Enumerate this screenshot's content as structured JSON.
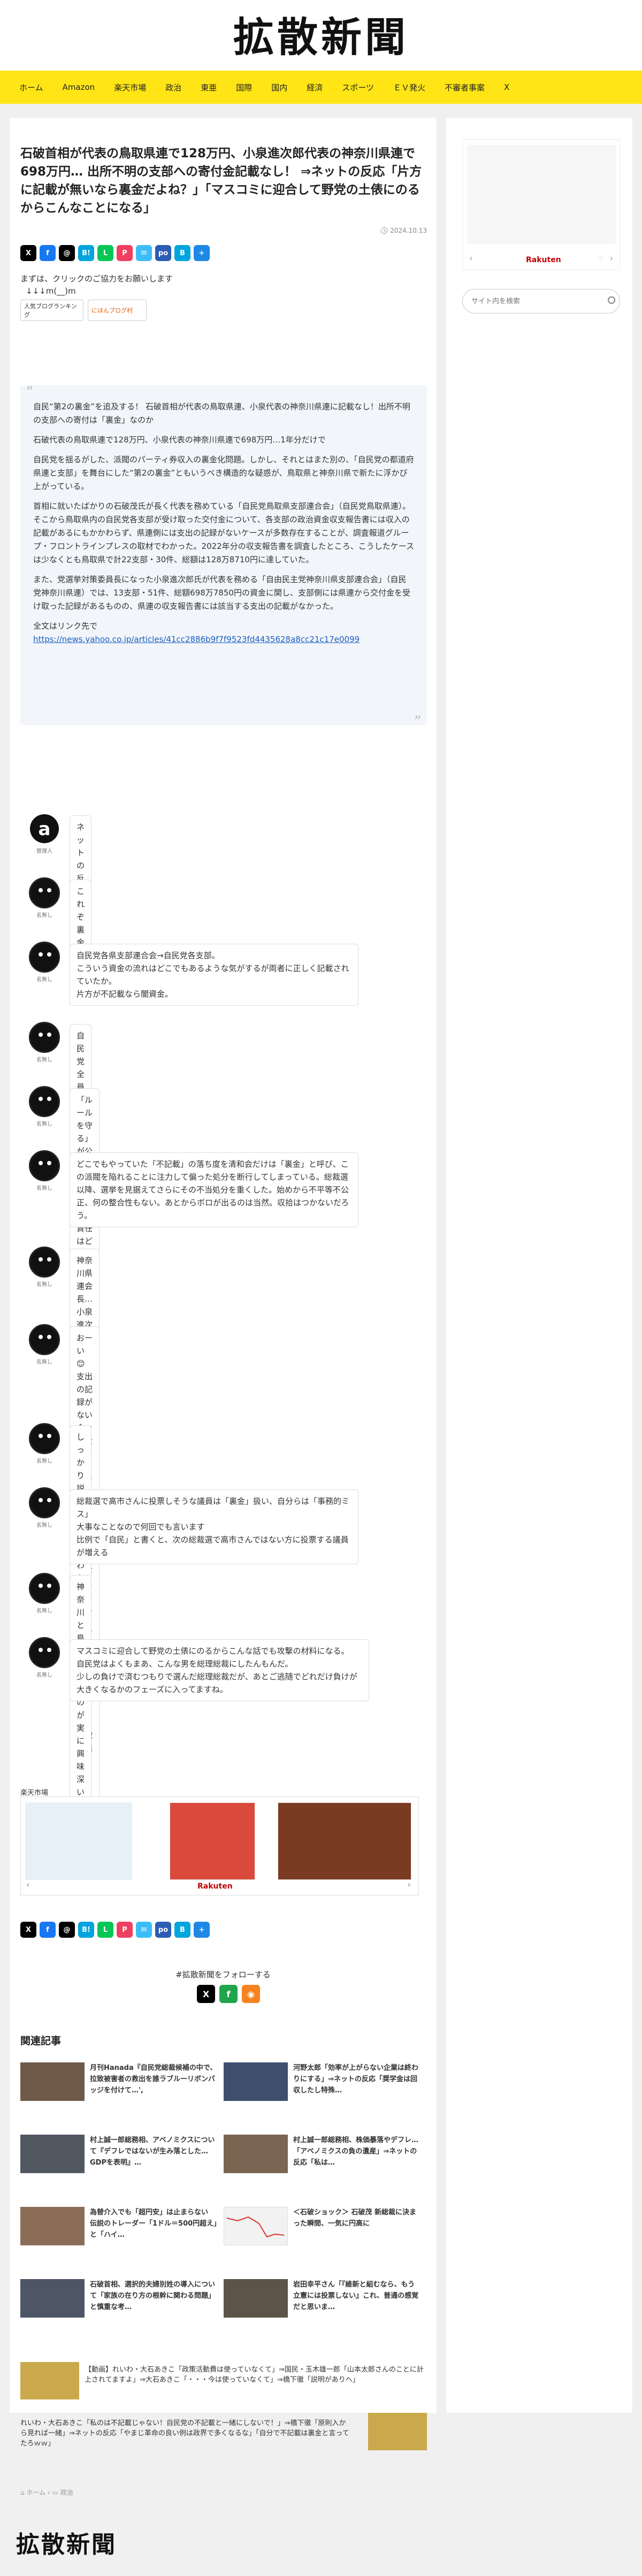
{
  "site": {
    "logo": "拡散新聞"
  },
  "nav": [
    "ホーム",
    "Amazon",
    "楽天市場",
    "政治",
    "東亜",
    "国際",
    "国内",
    "経済",
    "スポーツ",
    "ＥＶ発火",
    "不審者事案",
    "X"
  ],
  "article": {
    "title": "石破首相が代表の鳥取県連で128万円、小泉進次郎代表の神奈川県連で698万円… 出所不明の支部への寄付金記載なし！ ⇒ネットの反応「片方に記載が無いなら裏金だよね？」「マスコミに迎合して野党の土俵にのるからこんなことになる」",
    "date": "2024.10.13",
    "share_icons": [
      "X",
      "f",
      "@",
      "B!",
      "L",
      "P",
      "✉",
      "po",
      "B",
      "+"
    ],
    "click_request": "まずは、クリックのご協力をお願いします",
    "click_arrows": "↓↓↓m(__)m",
    "badges": [
      "人気ブログランキング",
      "にほんブログ村"
    ],
    "quote": {
      "p1": "自民“第2の裏金”を追及する！ 石破首相が代表の鳥取県連、小泉代表の神奈川県連に記載なし！出所不明の支部への寄付は「裏金」なのか",
      "p2": "石破代表の鳥取県連で128万円、小泉代表の神奈川県連で698万円…1年分だけで",
      "p3": "自民党を揺るがした、派閥のパーティ券収入の裏金化問題。しかし、それとはまた別の、「自民党の都道府県連と支部」を舞台にした“第2の裏金”ともいうべき構造的な疑惑が、鳥取県と神奈川県で新たに浮かび上がっている。",
      "p4": "首相に就いたばかりの石破茂氏が長く代表を務めている「自民党鳥取県支部連合会」（自民党鳥取県連）。そこから鳥取県内の自民党各支部が受け取った交付金について、各支部の政治資金収支報告書には収入の記載があるにもかかわらず、県連側には支出の記録がないケースが多数存在することが、調査報道グループ・フロントラインプレスの取材でわかった。2022年分の収支報告書を調査したところ、こうしたケースは少なくとも鳥取県で計22支部・30件、総額は128万8710円に達していた。",
      "p5": "また、党選挙対策委員長になった小泉進次郎氏が代表を務める「自由民主党神奈川県支部連合会」（自民党神奈川県連）では、13支部・51件、総額698万7850円の資金に関し、支部側には県連から交付金を受け取った記録があるものの、県連の収支報告書には該当する支出の記載がなかった。",
      "p6": "全文はリンク先で",
      "link": "https://news.yahoo.co.jp/articles/41cc2886b9f7f9523fd4435628a8cc21c17e0099"
    }
  },
  "reactions": [
    {
      "name": "管理人",
      "text": "ネットの反応"
    },
    {
      "name": "名無し",
      "text": "これぞ裏金"
    },
    {
      "name": "名無し",
      "text": "自民党各県支部連合会→自民党各支部。\nこういう資金の流れはどこでもあるような気がするが両者に正しく記載されていたか。\n片方が不記載なら闇資金。"
    },
    {
      "name": "名無し",
      "text": "自民党全員非公認ｗ"
    },
    {
      "name": "名無し",
      "text": "「ルールを守る」が公約の自民党さん、説明責任はどうした？"
    },
    {
      "name": "名無し",
      "text": "どこでもやっていた「不記載」の落ち度を清和会だけは「裏金」と呼び、この派閥を陥れることに注力して偏った処分を断行してしまっている。総裁選以降、選挙を見据えてさらにその不当処分を重くした。始めから不平等不公正、何の整合性もない。あとからボロが出るのは当然。収拾はつかないだろう。"
    },
    {
      "name": "名無し",
      "text": "神奈川県連会長…小泉進次郎\n鳥取県連会長…石破茂\n…さぁ、しっかり説明を"
    },
    {
      "name": "名無し",
      "text": "おーい😊\n支出の記録がない金＝裏金でしょ？\nルールを守るって小学生みたいな公約に既に違反してますね？\n石破さん？小泉さん？\n公認取消しな？😊"
    },
    {
      "name": "名無し",
      "text": "しっかり説明してもらわないといけません"
    },
    {
      "name": "名無し",
      "text": "総裁選で高市さんに投票しそうな議員は「裏金」扱い、自分らは「事務的ミス」\n大事なことなので何回でも言います\n比例で「自民」と書くと、次の総裁選で高市さんではない方に投票する議員が増える"
    },
    {
      "name": "名無し",
      "text": "神奈川と鳥取というのが実に興味深いですね"
    },
    {
      "name": "名無し",
      "text": "マスコミに迎合して野党の土俵にのるからこんな話でも攻撃の材料になる。\n自民党はよくもまあ、こんな男を総理総裁にしたんもんだ。\n少しの負けで済むつもりで選んだ総理総裁だが、あとご逃随でどれだけ負けが大きくなるかのフェーズに入ってますね。"
    }
  ],
  "market": {
    "title": "楽天市場",
    "brand": "Rakuten"
  },
  "follow": {
    "title": "#拡散新聞をフォローする"
  },
  "related": {
    "title": "関連記事",
    "items": [
      "月刊Hanada『自民党総裁候補の中で、拉致被害者の救出を誰ラブルーリボンバッジを付けて…',",
      "河野太郎「効率が上がらない企業は終わりにする」⇒ネットの反応「奨学金は回収したし特殊…",
      "村上誠一郎総務相、アベノミクスについて『デフレではないが生み落とした…GDPを表明』…",
      "村上誠一郎総務相、株価暴落やデフレ… 「アベノミクスの負の遺産」⇒ネットの反応「私は…",
      "為替介入でも「超円安」は止まらない　伝説のトレーダー「1ドル＝500円超え」と「ハイ…",
      "＜石破ショック＞ 石破茂 新総裁に決まった瞬間、一気に円高に",
      "石破首相、選択的夫婦別姓の導入について「家族の在り方の根幹に関わる問題」と慎重な考…",
      "岩田幸平さん「『維新と組むなら、もう立憲には投票しない』これ、普通の感覚だと思いま…"
    ]
  },
  "trends": [
    "【動画】れいわ・大石あきこ「政策活動費は使っていなくて」⇒国民・玉木雄一郎「山本太郎さんのことに計上されてますよ」⇒大石あきこ「・・・今は使っていなくて」⇒橋下徹「説明がありへ」",
    "れいわ・大石あきこ「私のは不記載じゃない！自民党の不記載と一緒にしないで！」⇒橋下徹「原則入から見れば一緒」⇒ネットの反応「やまじ革命の良い例は政界で多くなるな」「自分で不記載は裏金と言ってたろｗｗ」"
  ],
  "breadcrumb": [
    "ホーム",
    "政治"
  ],
  "sidebar": {
    "search_placeholder": "サイト内を検索",
    "ad_brand": "Rakuten"
  },
  "footer": {
    "logo": "拡散新聞"
  },
  "colors": {
    "nav_bg": "#ffe516",
    "link": "#1a5ec2",
    "rakuten": "#bf0000"
  }
}
